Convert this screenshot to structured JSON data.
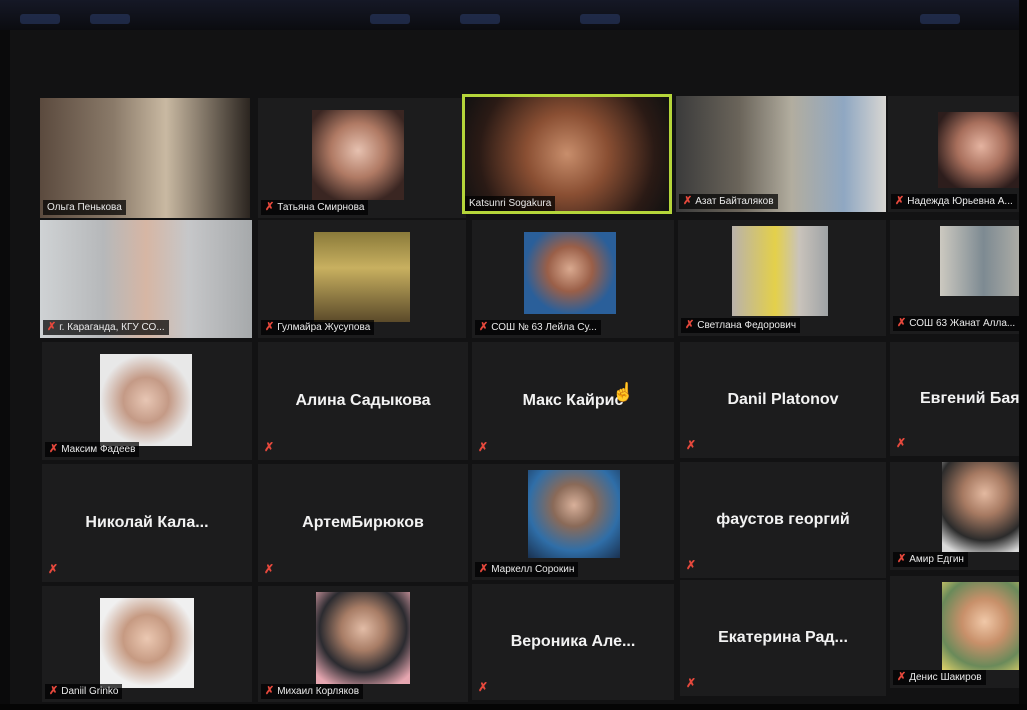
{
  "app": {
    "title": "Zoom gallery view"
  },
  "colors": {
    "active_speaker_border": "#b5d53a",
    "muted_icon": "#e5483c",
    "tile_bg": "#1c1c1d"
  },
  "participants": [
    {
      "name": "Ольга Пенькова",
      "muted": false
    },
    {
      "name": "Татьяна Смирнова",
      "muted": true
    },
    {
      "name": "Katsunri Sogakura",
      "muted": false,
      "active_speaker": true
    },
    {
      "name": "Азат Байталяков",
      "muted": true
    },
    {
      "name": "Надежда Юрьевна А...",
      "muted": true
    },
    {
      "name": "г. Караганда, КГУ СО...",
      "muted": true
    },
    {
      "name": "Гулмайра Жусупова",
      "muted": true
    },
    {
      "name": "СОШ № 63 Лейла Су...",
      "muted": true
    },
    {
      "name": "Светлана Федорович",
      "muted": true
    },
    {
      "name": "СОШ 63 Жанат Алла...",
      "muted": true
    },
    {
      "name": "Максим Фадеев",
      "muted": true
    },
    {
      "name": "Алина Садыкова",
      "muted": true
    },
    {
      "name": "Макс Кайрис",
      "muted": true
    },
    {
      "name": "Danil Platonov",
      "muted": true
    },
    {
      "name": "Евгений Баян",
      "muted": true
    },
    {
      "name": "Николай  Кала...",
      "muted": true
    },
    {
      "name": "АртемБирюков",
      "muted": true
    },
    {
      "name": "Маркелл Сорокин",
      "muted": true
    },
    {
      "name": "фаустов георгий",
      "muted": true
    },
    {
      "name": "Амир Едгин",
      "muted": true
    },
    {
      "name": "Daniil Grinko",
      "muted": true
    },
    {
      "name": "Михаил Корляков",
      "muted": true
    },
    {
      "name": "Вероника  Але...",
      "muted": true
    },
    {
      "name": "Екатерина  Рад...",
      "muted": true
    },
    {
      "name": "Денис Шакиров",
      "muted": true
    }
  ],
  "icons": {
    "mic_muted": "mic-muted-icon",
    "cursor": "hand-pointer-icon"
  }
}
